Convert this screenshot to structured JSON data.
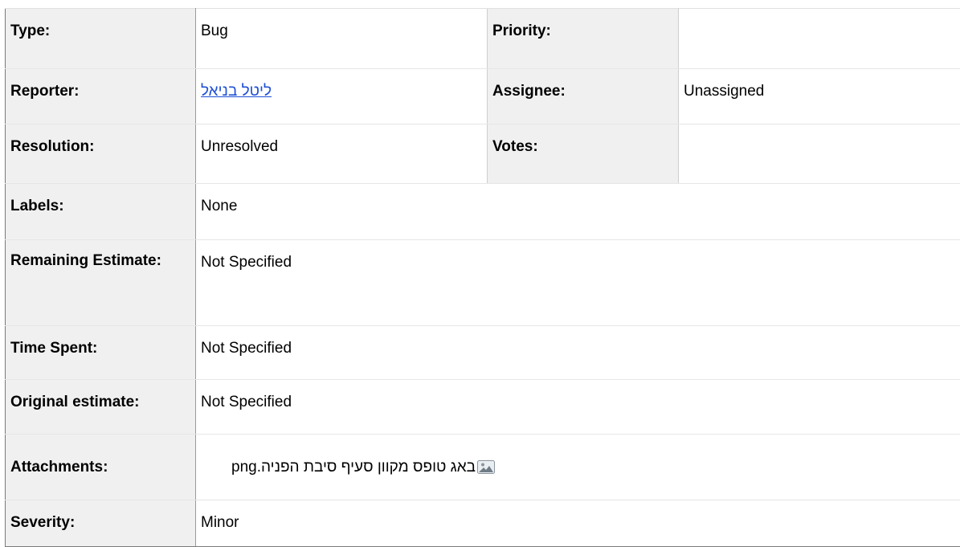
{
  "fields": {
    "type_label": "Type:",
    "type_value": "Bug",
    "priority_label": "Priority:",
    "priority_value": "",
    "reporter_label": "Reporter:",
    "reporter_value": "ליטל בניאל",
    "assignee_label": "Assignee:",
    "assignee_value": "Unassigned",
    "resolution_label": "Resolution:",
    "resolution_value": "Unresolved",
    "votes_label": "Votes:",
    "votes_value": "",
    "labels_label": "Labels:",
    "labels_value": "None",
    "remaining_label": "Remaining Estimate:",
    "remaining_value": "Not Specified",
    "time_spent_label": "Time Spent:",
    "time_spent_value": "Not Specified",
    "original_label": "Original estimate:",
    "original_value": "Not Specified",
    "attachments_label": "Attachments:",
    "severity_label": "Severity:",
    "severity_value": "Minor"
  },
  "attachments": [
    {
      "filename": "באג טופס מקוון סעיף סיבת הפניה.png",
      "icon": "image-file-icon"
    }
  ],
  "colors": {
    "label_background": "#f0f0f0",
    "link": "#1f4fd6",
    "border": "#d6d6d6"
  }
}
